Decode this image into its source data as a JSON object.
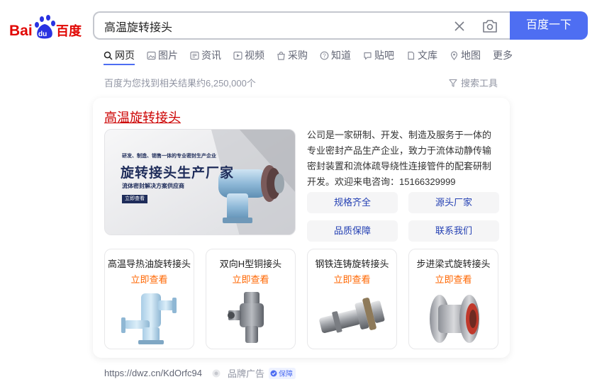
{
  "logo": {
    "text_left": "Bai",
    "text_paw": "du",
    "text_right": "百度"
  },
  "search": {
    "query": "高温旋转接头",
    "button_label": "百度一下"
  },
  "tabs": [
    {
      "label": "网页",
      "icon": "search-icon",
      "active": true
    },
    {
      "label": "图片",
      "icon": "image-icon"
    },
    {
      "label": "资讯",
      "icon": "news-icon"
    },
    {
      "label": "视频",
      "icon": "video-icon"
    },
    {
      "label": "采购",
      "icon": "shopping-icon"
    },
    {
      "label": "知道",
      "icon": "question-icon"
    },
    {
      "label": "贴吧",
      "icon": "forum-icon"
    },
    {
      "label": "文库",
      "icon": "document-icon"
    },
    {
      "label": "地图",
      "icon": "map-pin-icon"
    },
    {
      "label": "更多"
    }
  ],
  "result_count": "百度为您找到相关结果约6,250,000个",
  "search_tools": "搜索工具",
  "ad_card": {
    "title": "高温旋转接头",
    "banner": {
      "small_text": "研发、制造、销售一体的专业密封生产企业",
      "big_text": "旋转接头生产厂家",
      "sub_text": "流体密封解决方案供应商",
      "button": "立即查看"
    },
    "intro": "公司是一家研制、开发、制造及服务于一体的专业密封产品生产企业，致力于流体动静传输密封装置和流体疏导绕性连接管件的配套研制开发。欢迎来电咨询：15166329999",
    "links": [
      "规格齐全",
      "源头厂家",
      "品质保障",
      "联系我们"
    ],
    "products": [
      {
        "name": "高温导热油旋转接头",
        "cta": "立即查看"
      },
      {
        "name": "双向H型铜接头",
        "cta": "立即查看"
      },
      {
        "name": "钢铁连铸旋转接头",
        "cta": "立即查看"
      },
      {
        "name": "步进梁式旋转接头",
        "cta": "立即查看"
      }
    ]
  },
  "footer": {
    "url": "https://dwz.cn/KdOrfc94",
    "ad_label": "品牌广告",
    "badge": "保障"
  },
  "colors": {
    "brand_blue": "#4e6ef2",
    "title_red": "#cc0000",
    "cta_orange": "#ff6600",
    "link_blue": "#2440b3"
  }
}
